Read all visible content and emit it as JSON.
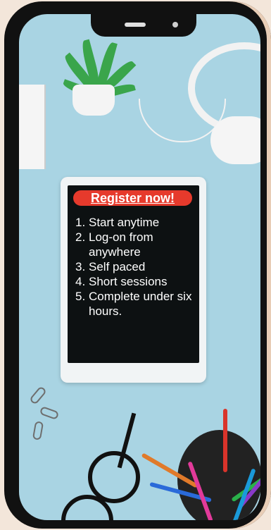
{
  "cta": {
    "label": "Register now!"
  },
  "steps": [
    {
      "num": "1.",
      "text": "Start anytime"
    },
    {
      "num": "2.",
      "text": "Log-on from anywhere"
    },
    {
      "num": "3.",
      "text": "Self paced"
    },
    {
      "num": "4.",
      "text": "Short sessions"
    },
    {
      "num": "5.",
      "text": "Complete under six hours."
    }
  ],
  "colors": {
    "button": "#e63a2c",
    "background": "#a9d4e3",
    "tablet_screen": "#0d1112"
  },
  "icons": [
    "plant-icon",
    "headphones-icon",
    "glasses-icon",
    "pencils-icon",
    "paperclip-icon"
  ]
}
